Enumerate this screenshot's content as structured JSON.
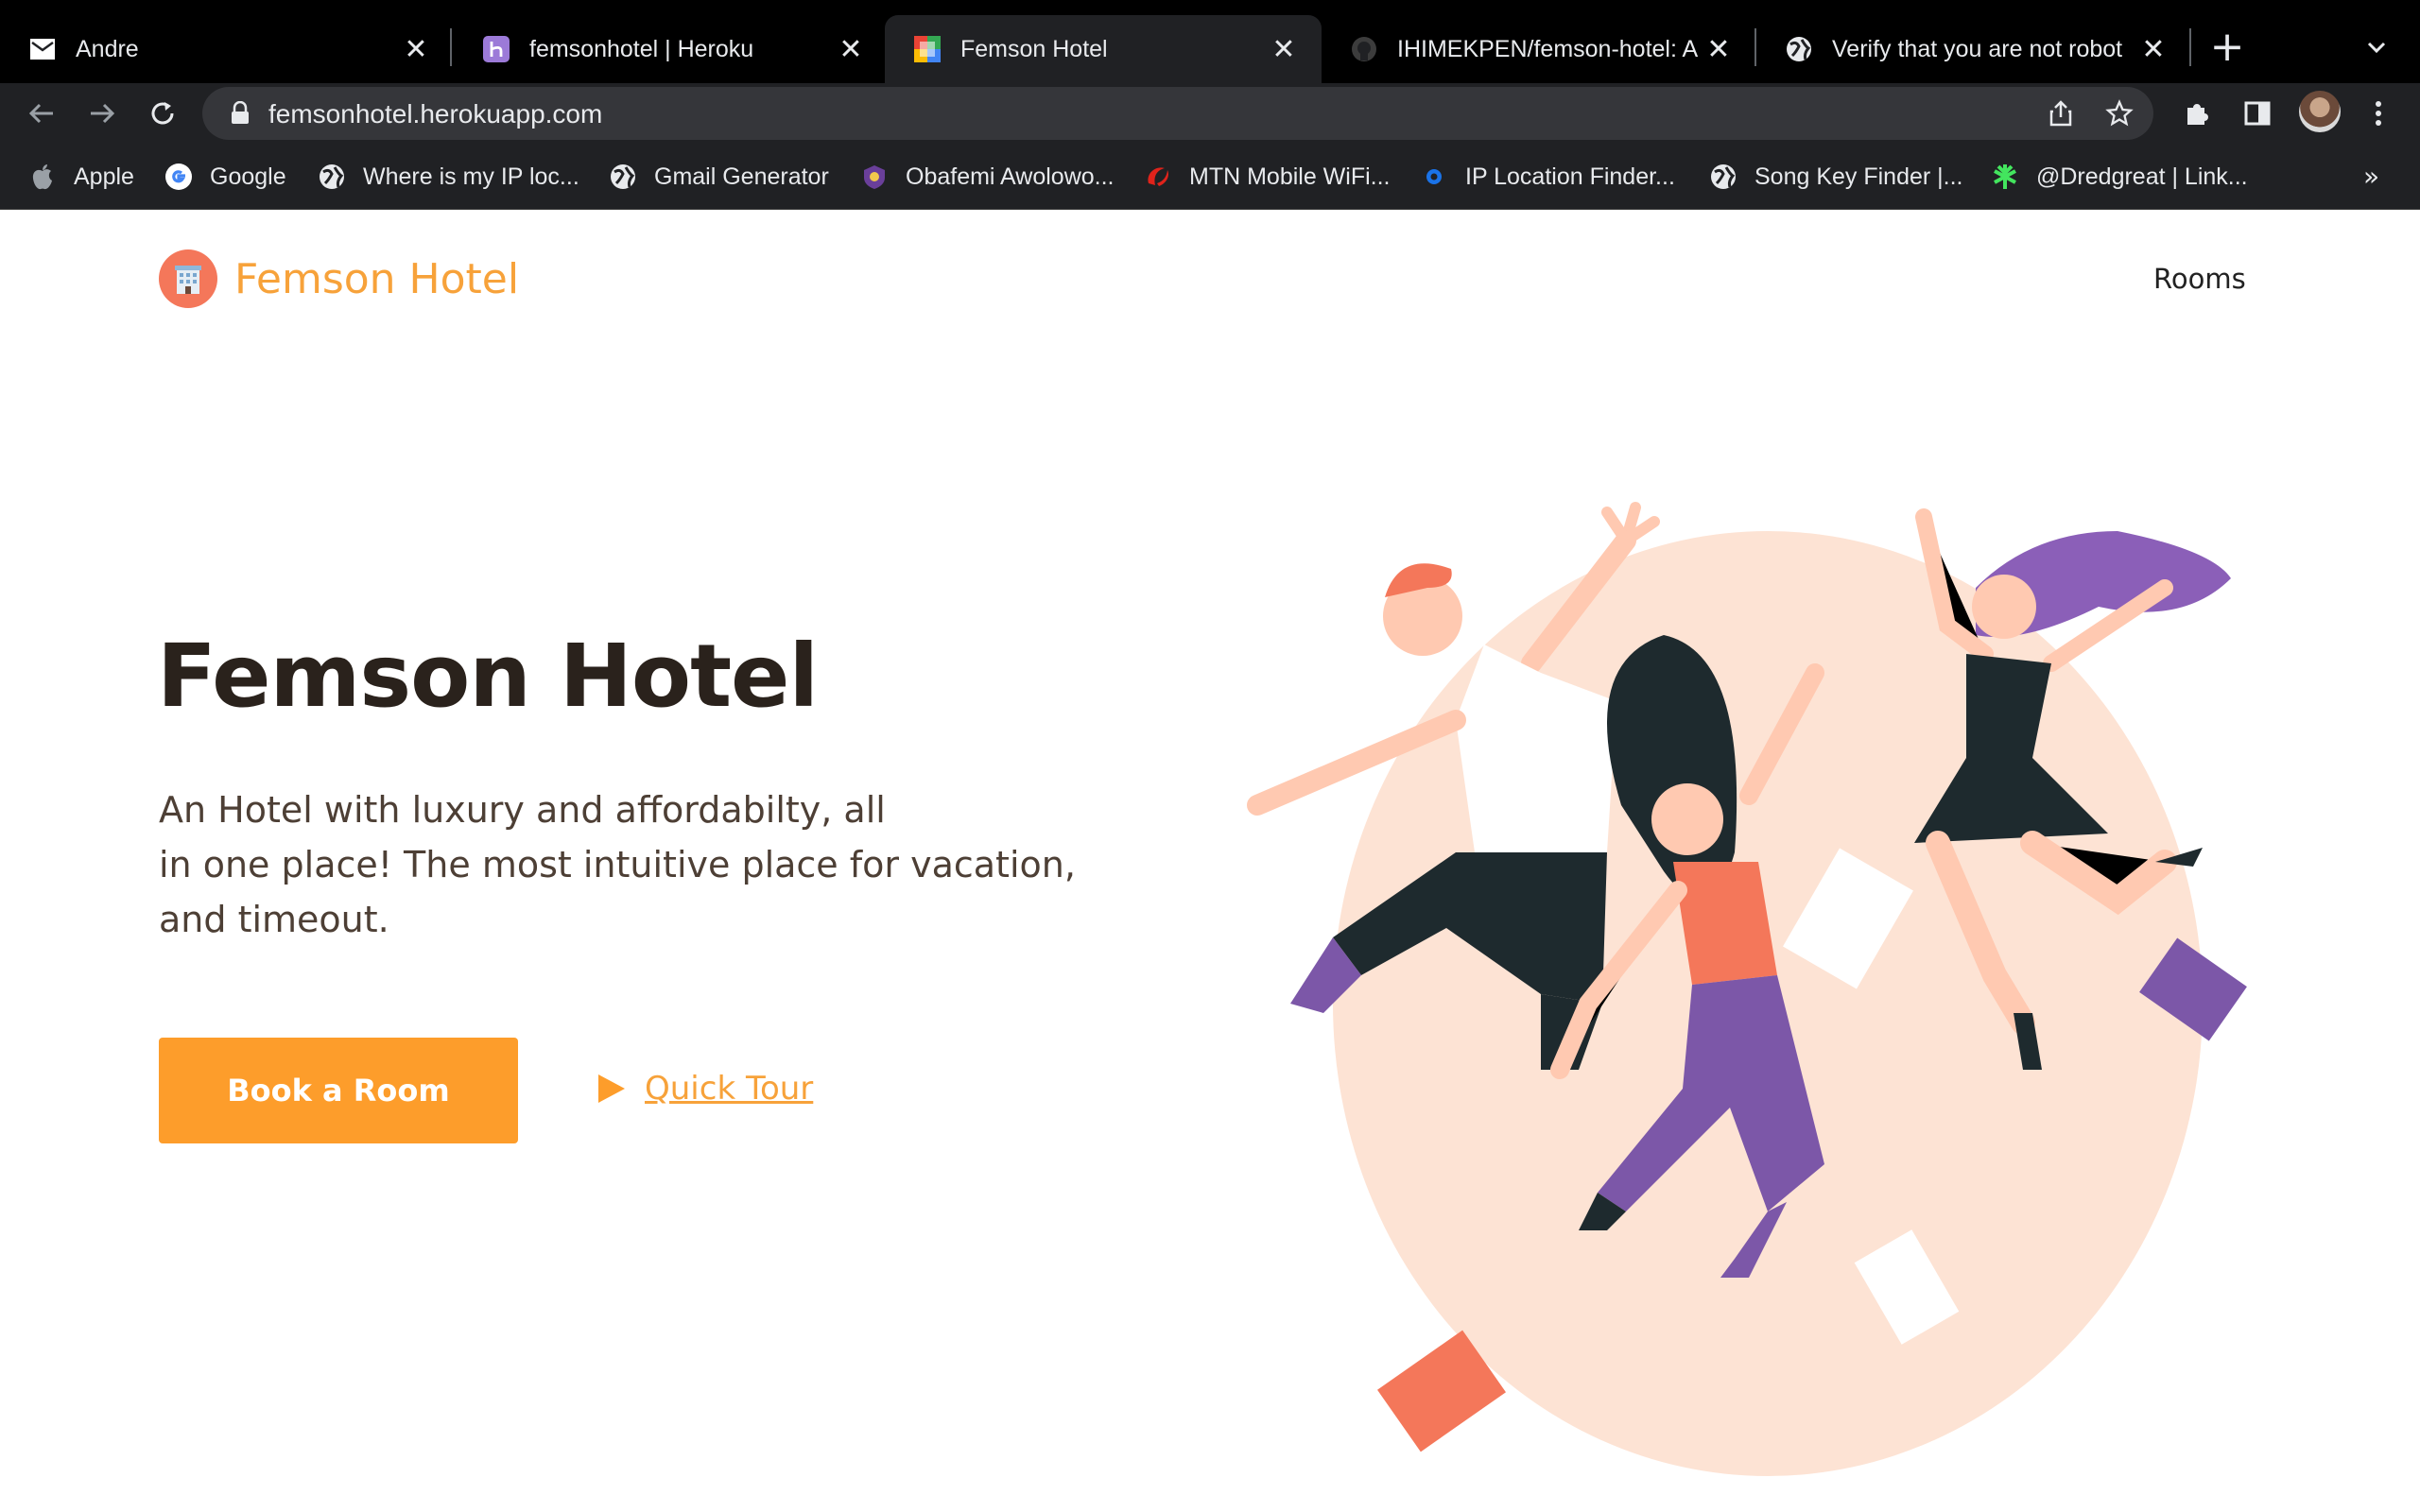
{
  "browser": {
    "tabs": [
      {
        "title": "Andre",
        "icon": "mail-icon"
      },
      {
        "title": "femsonhotel | Heroku",
        "icon": "heroku-icon"
      },
      {
        "title": "Femson Hotel",
        "icon": "femson-favicon",
        "active": true
      },
      {
        "title": "IHIMEKPEN/femson-hotel: A l",
        "icon": "github-icon"
      },
      {
        "title": "Verify that you are not robot",
        "icon": "globe-icon"
      }
    ],
    "url": "femsonhotel.herokuapp.com",
    "bookmarks": [
      {
        "label": "Apple",
        "icon": "apple-icon"
      },
      {
        "label": "Google",
        "icon": "google-icon"
      },
      {
        "label": "Where is my IP loc...",
        "icon": "globe-icon"
      },
      {
        "label": "Gmail Generator",
        "icon": "globe-icon"
      },
      {
        "label": "Obafemi Awolowo...",
        "icon": "university-crest-icon"
      },
      {
        "label": "MTN Mobile WiFi...",
        "icon": "mtn-icon"
      },
      {
        "label": "IP Location Finder...",
        "icon": "ip-icon"
      },
      {
        "label": "Song Key Finder |...",
        "icon": "globe-icon"
      },
      {
        "label": "@Dredgreat | Link...",
        "icon": "linktree-icon"
      }
    ],
    "more_bookmarks": "»"
  },
  "site": {
    "brand": "Femson Hotel",
    "nav": {
      "rooms": "Rooms"
    },
    "hero": {
      "title": "Femson Hotel",
      "description_lines": [
        "An Hotel with luxury and affordabilty, all",
        "in one place! The most intuitive place for vacation,",
        "and timeout."
      ],
      "cta_primary": "Book a Room",
      "cta_secondary": "Quick Tour"
    },
    "colors": {
      "accent": "#fd9d2b",
      "brand_text": "#f7a23a",
      "title": "#2a221c",
      "body_text": "#4d3f35",
      "illustration_bg": "#fde3d4"
    }
  }
}
